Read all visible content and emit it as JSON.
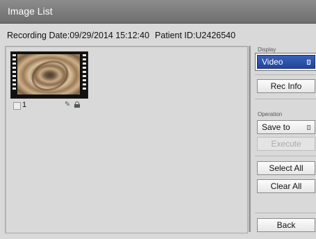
{
  "window": {
    "title": "Image List"
  },
  "recording": {
    "date_label": "Recording Date:09/29/2014 15:12:40",
    "patient_label": "Patient ID:U2426540"
  },
  "gallery": {
    "items": [
      {
        "number": "1",
        "icons": [
          "protect-icon",
          "lock-icon"
        ]
      }
    ]
  },
  "sidebar": {
    "display_label": "Display",
    "display_value": "Video",
    "rec_info_label": "Rec Info",
    "operation_label": "Operation",
    "save_to_label": "Save to",
    "execute_label": "Execute",
    "select_all_label": "Select All",
    "clear_all_label": "Clear All",
    "back_label": "Back"
  },
  "colors": {
    "selected_button": "#2a4ea6",
    "title_bar": "#7d7d7d",
    "background": "#d9d9d9"
  }
}
